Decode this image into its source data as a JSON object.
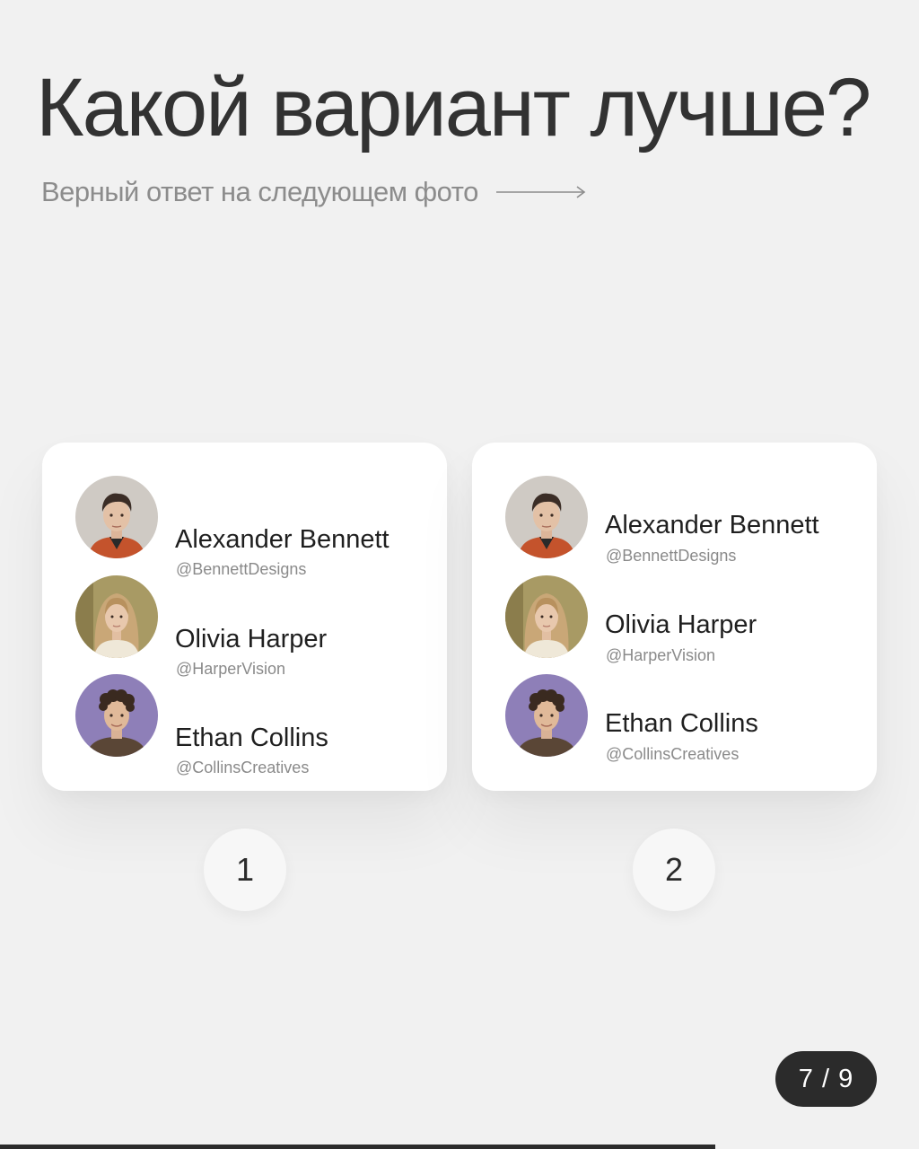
{
  "title": "Какой вариант лучше?",
  "subtitle": "Верный ответ на следующем фото",
  "subtitle_arrow_icon": "long-arrow-right-icon",
  "cards": [
    {
      "profiles": [
        {
          "name": "Alexander Bennett",
          "handle": "@BennettDesigns",
          "avatar_icon": "man-portrait-avatar"
        },
        {
          "name": "Olivia Harper",
          "handle": "@HarperVision",
          "avatar_icon": "woman-portrait-avatar"
        },
        {
          "name": "Ethan Collins",
          "handle": "@CollinsCreatives",
          "avatar_icon": "curly-man-portrait-avatar"
        }
      ],
      "option_label": "1"
    },
    {
      "profiles": [
        {
          "name": "Alexander Bennett",
          "handle": "@BennettDesigns",
          "avatar_icon": "man-portrait-avatar"
        },
        {
          "name": "Olivia Harper",
          "handle": "@HarperVision",
          "avatar_icon": "woman-portrait-avatar"
        },
        {
          "name": "Ethan Collins",
          "handle": "@CollinsCreatives",
          "avatar_icon": "curly-man-portrait-avatar"
        }
      ],
      "option_label": "2"
    }
  ],
  "pager": "7 / 9",
  "progress": 0.778,
  "colors": {
    "background": "#f1f1f1",
    "card": "#ffffff",
    "title": "#323232",
    "subtitle": "#8c8c8c",
    "pager_bg": "#2b2b2b",
    "avatar_purple": "#8e7fb8"
  }
}
